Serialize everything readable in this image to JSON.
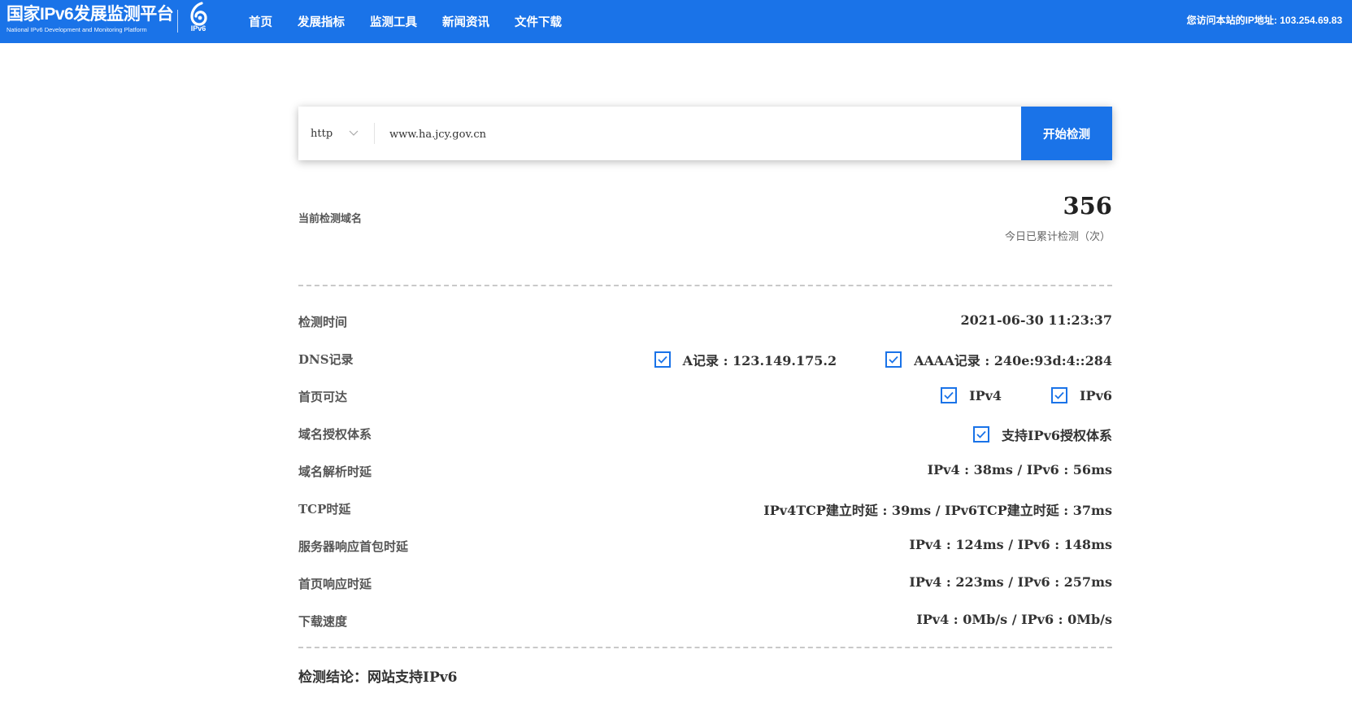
{
  "header": {
    "brand_title": "国家IPv6发展监测平台",
    "brand_subtitle": "National IPv6 Development and Monitoring Platform",
    "logo_text": "IPv6",
    "nav": [
      "首页",
      "发展指标",
      "监测工具",
      "新闻资讯",
      "文件下载"
    ],
    "ip_info": "您访问本站的IP地址: 103.254.69.83"
  },
  "search": {
    "protocol": "http",
    "domain": "www.ha.jcy.gov.cn",
    "button": "开始检测"
  },
  "stats": {
    "current_domain_label": "当前检测域名",
    "count": "356",
    "count_label": "今日已累计检测（次）"
  },
  "results": {
    "time_label": "检测时间",
    "time_value": "2021-06-30 11:23:37",
    "dns_label": "DNS记录",
    "dns_a": "A记录 : 123.149.175.2",
    "dns_aaaa": "AAAA记录 : 240e:93d:4::284",
    "home_label": "首页可达",
    "home_ipv4": "IPv4",
    "home_ipv6": "IPv6",
    "auth_label": "域名授权体系",
    "auth_value": "支持IPv6授权体系",
    "resolve_label": "域名解析时延",
    "resolve_value": "IPv4 : 38ms / IPv6 : 56ms",
    "tcp_label": "TCP时延",
    "tcp_value": "IPv4TCP建立时延 : 39ms / IPv6TCP建立时延 : 37ms",
    "server_label": "服务器响应首包时延",
    "server_value": "IPv4 : 124ms / IPv6 : 148ms",
    "page_label": "首页响应时延",
    "page_value": "IPv4 : 223ms / IPv6 : 257ms",
    "download_label": "下载速度",
    "download_value": "IPv4 : 0Mb/s / IPv6 : 0Mb/s",
    "conclusion": "检测结论：网站支持IPv6"
  },
  "colors": {
    "primary": "#1a73e8",
    "divider": "#c9c9c9"
  }
}
